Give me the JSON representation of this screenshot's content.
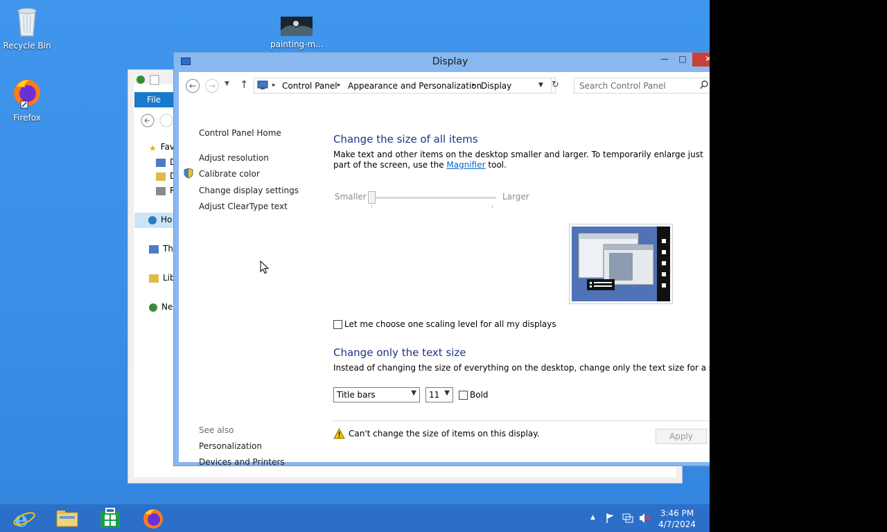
{
  "desktop": {
    "icons": [
      {
        "label": "Recycle Bin",
        "icon": "recycle-bin-icon"
      },
      {
        "label": "Firefox",
        "icon": "firefox-icon"
      },
      {
        "label": "painting-m...",
        "icon": "image-thumbnail-icon"
      }
    ]
  },
  "explorer_bg": {
    "file_tab": "File",
    "nav_items": [
      "Fav",
      "D",
      "D",
      "R",
      "Ho",
      "Thi",
      "Lib",
      "Ne"
    ]
  },
  "window": {
    "title": "Display",
    "address": {
      "crumbs": [
        "Control Panel",
        "Appearance and Personalization",
        "Display"
      ]
    },
    "search_placeholder": "Search Control Panel",
    "left_pane": {
      "home": "Control Panel Home",
      "links": [
        "Adjust resolution",
        "Calibrate color",
        "Change display settings",
        "Adjust ClearType text"
      ],
      "see_also_label": "See also",
      "see_also": [
        "Personalization",
        "Devices and Printers"
      ]
    },
    "main": {
      "heading1": "Change the size of all items",
      "desc1_part1": "Make text and other items on the desktop smaller and larger. To temporarily enlarge just part of the screen, use the",
      "desc1_link": "Magnifier",
      "desc1_part2": "tool.",
      "slider_min_label": "Smaller",
      "slider_max_label": "Larger",
      "slider_position": 0,
      "checkbox_label": "Let me choose one scaling level for all my displays",
      "checkbox_checked": false,
      "heading2": "Change only the text size",
      "desc2": "Instead of changing the size of everything on the desktop, change only the text size for a specific item.",
      "item_select_value": "Title bars",
      "size_select_value": "11",
      "bold_label": "Bold",
      "bold_checked": false,
      "warning_text": "Can't change the size of items on this display.",
      "apply_label": "Apply"
    }
  },
  "taskbar": {
    "apps": [
      "internet-explorer-icon",
      "file-explorer-icon",
      "store-icon",
      "firefox-icon"
    ],
    "time": "3:46 PM",
    "date": "4/7/2024"
  }
}
